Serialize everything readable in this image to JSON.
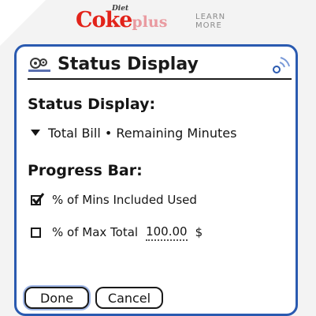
{
  "banner": {
    "brand_main": "Coke",
    "brand_diet": "Diet",
    "brand_plus": "plus",
    "learn_line1": "LEARN",
    "learn_line2": "MORE",
    "brand_color": "#e2231a"
  },
  "dialog": {
    "title": "Status Display",
    "title_icon": "gears-icon",
    "signal_icon": "signal-icon",
    "border_color": "#2a5ab0"
  },
  "status_display": {
    "heading": "Status Display:",
    "selected_value": "Total Bill • Remaining Minutes"
  },
  "progress_bar": {
    "heading": "Progress Bar:",
    "option_mins": {
      "label": "% of Mins Included Used",
      "checked": true
    },
    "option_max": {
      "label": "% of Max Total",
      "checked": false,
      "amount": "100.00",
      "currency": "$"
    }
  },
  "buttons": {
    "done": "Done",
    "cancel": "Cancel"
  }
}
